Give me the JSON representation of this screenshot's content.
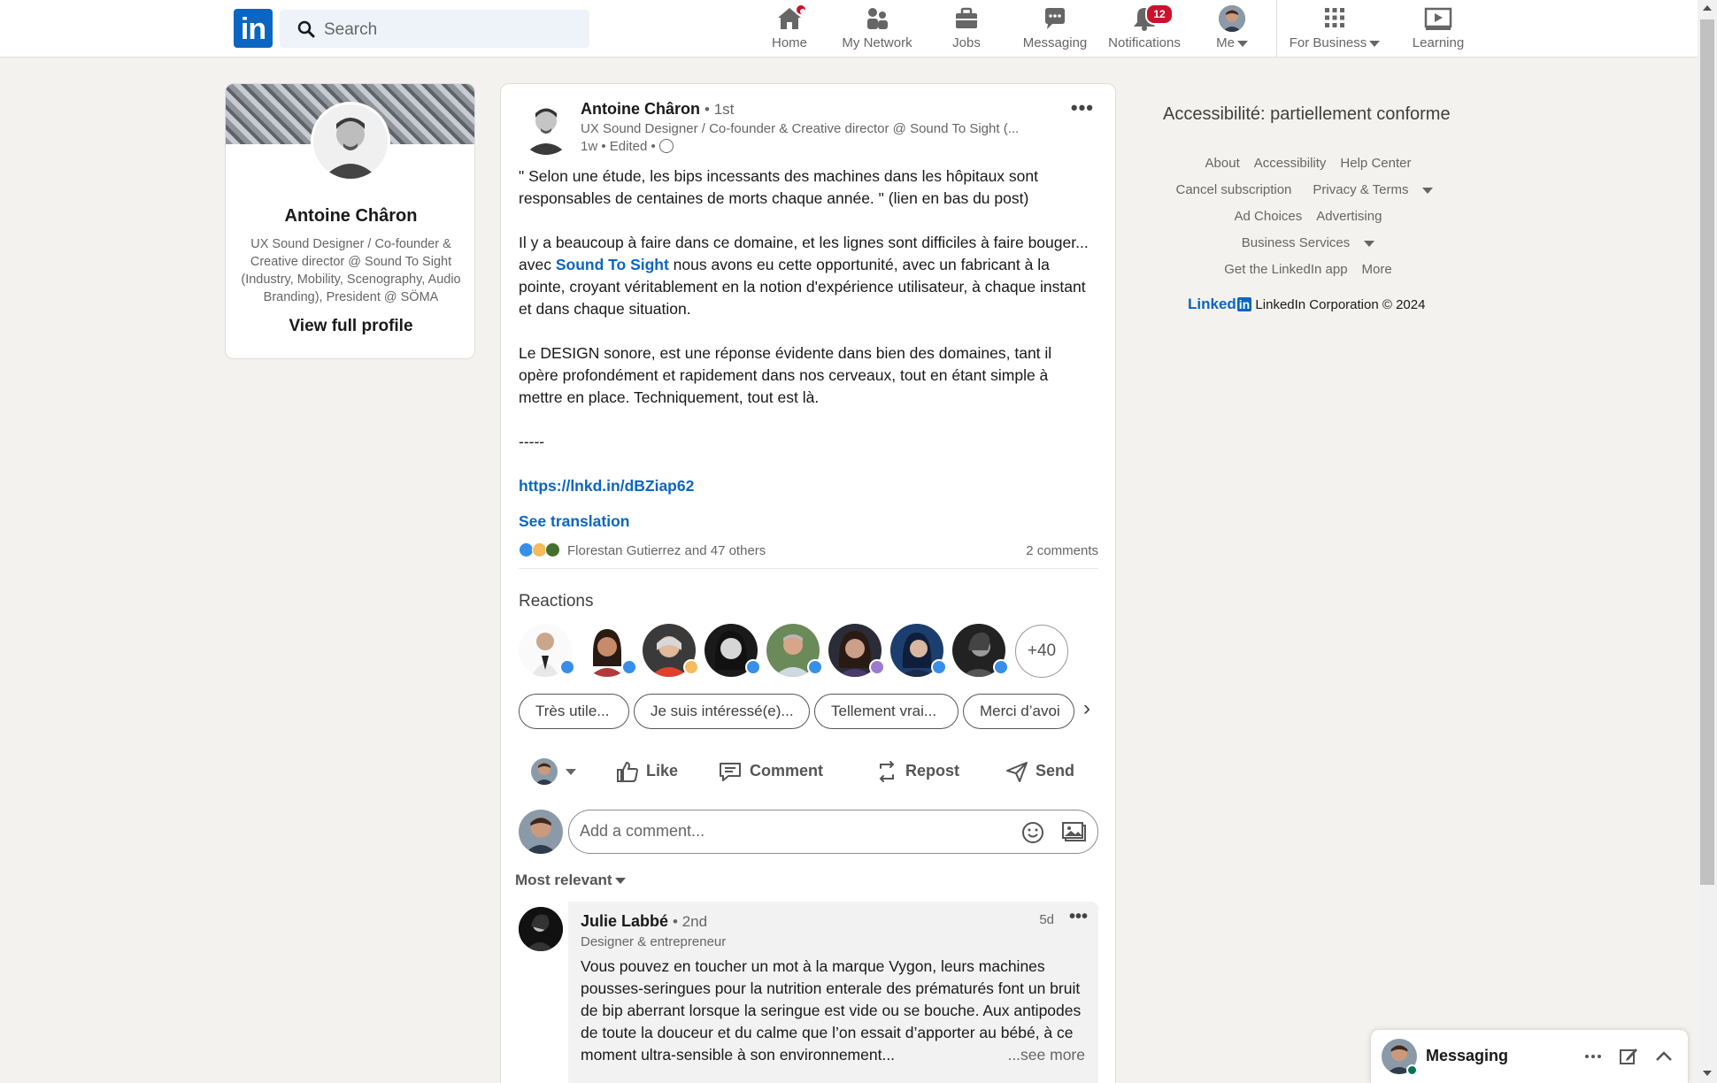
{
  "nav": {
    "logo": "in",
    "search_placeholder": "Search",
    "items": [
      {
        "label": "Home"
      },
      {
        "label": "My Network"
      },
      {
        "label": "Jobs"
      },
      {
        "label": "Messaging"
      },
      {
        "label": "Notifications",
        "badge": "12"
      },
      {
        "label": "Me"
      },
      {
        "label": "For Business"
      },
      {
        "label": "Learning"
      }
    ],
    "accent_color": "#0a66c2",
    "badge_color": "#cb112d"
  },
  "profile": {
    "name": "Antoine Châron",
    "headline": "UX Sound Designer / Co-founder & Creative director @ Sound To Sight (Industry, Mobility, Scenography, Audio Branding), President @ SÖMA",
    "view_profile": "View full profile"
  },
  "post": {
    "author": "Antoine Châron",
    "degree": "• 1st",
    "headline": "UX Sound Designer / Co-founder & Creative director @ Sound To Sight (...",
    "meta": "1w • Edited •",
    "para1": "\" Selon une étude, les bips incessants des machines dans les hôpitaux sont responsables de centaines de morts chaque année. \" (lien en bas du post)",
    "para2_a": "Il y a beaucoup à faire dans ce domaine, et les lignes sont difficiles à faire bouger... avec ",
    "para2_link": "Sound To Sight",
    "para2_b": " nous avons eu cette opportunité, avec un fabricant à la pointe, croyant véritablement en la notion d'expérience utilisateur, à chaque instant et dans chaque situation.",
    "para3": "Le DESIGN sonore, est une réponse évidente dans bien des domaines, tant il opère profondément et rapidement dans nos cerveaux, tout en étant simple à mettre en place. Techniquement, tout est là.",
    "separator": "-----",
    "url": "https://lnkd.in/dBZiap62",
    "see_translation": "See translation",
    "reactions_summary": "Florestan Gutierrez and 47 others",
    "comments_count": "2 comments",
    "reactions_title": "Reactions",
    "more_reactors": "+40",
    "chips": [
      "Très utile...",
      "Je suis intéressé(e)...",
      "Tellement vrai...",
      "Merci d’avoi"
    ],
    "actions": {
      "like": "Like",
      "comment": "Comment",
      "repost": "Repost",
      "send": "Send"
    },
    "comment_placeholder": "Add a comment...",
    "sort_label": "Most relevant"
  },
  "comment": {
    "author": "Julie Labbé",
    "degree": "• 2nd",
    "headline": "Designer & entrepreneur",
    "time": "5d",
    "text": "Vous pouvez en toucher un mot à la marque Vygon, leurs machines pousses-seringues pour la nutrition enterale des prématurés font un bruit de bip aberrant lorsque la seringue est vide ou se bouche. Aux antipodes de toute la douceur et du calme que l’on essait d’apporter au bébé, à ce moment ultra-sensible à son environnement...",
    "see_more": "...see more"
  },
  "footer": {
    "accessibility": "Accessibilité: partiellement conforme",
    "links": [
      "About",
      "Accessibility",
      "Help Center",
      "Cancel subscription",
      "Privacy & Terms",
      "Ad Choices",
      "Advertising",
      "Business Services",
      "Get the LinkedIn app",
      "More"
    ],
    "brand": "Linked",
    "brand_in": "in",
    "copyright": "LinkedIn Corporation © 2024"
  },
  "messaging": {
    "label": "Messaging"
  }
}
